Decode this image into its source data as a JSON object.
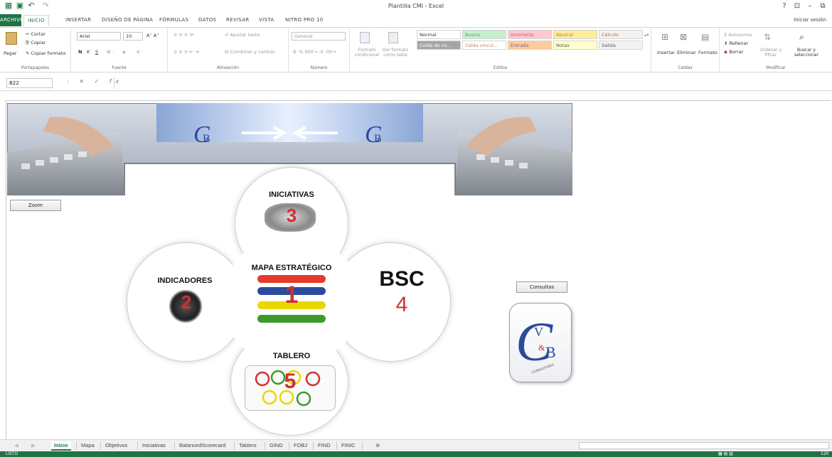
{
  "window": {
    "title": "Plantilla CMI - Excel",
    "help": "?",
    "sign_in": "Iniciar sesión"
  },
  "ribbon_tabs": [
    "ARCHIVO",
    "INICIO",
    "INSERTAR",
    "DISEÑO DE PÁGINA",
    "FÓRMULAS",
    "DATOS",
    "REVISAR",
    "VISTA",
    "NITRO PRO 10"
  ],
  "ribbon": {
    "clipboard": {
      "paste": "Pegar",
      "cut": "Cortar",
      "copy": "Copiar",
      "copy_format": "Copiar formato",
      "label": "Portapapeles"
    },
    "font": {
      "name": "Arial",
      "size": "10",
      "bold": "N",
      "italic": "K",
      "underline": "S",
      "label": "Fuente"
    },
    "alignment": {
      "wrap": "Ajustar texto",
      "merge": "Combinar y centrar",
      "label": "Alineación"
    },
    "number": {
      "format": "General",
      "label": "Número"
    },
    "styles": {
      "cond_format": "Formato condicional",
      "as_table": "Dar formato como tabla",
      "cells": [
        "Normal",
        "Buena",
        "Incorrecto",
        "Neutral",
        "Cálculo",
        "Celda de co...",
        "Celda vincul...",
        "Entrada",
        "Notas",
        "Salida"
      ],
      "label": "Estilos"
    },
    "cells": {
      "insert": "Insertar",
      "delete": "Eliminar",
      "format": "Formato",
      "label": "Celdas"
    },
    "editing": {
      "autosum": "Autosuma",
      "fill": "Rellenar",
      "clear": "Borrar",
      "sort": "Ordenar y filtrar",
      "find": "Buscar y seleccionar",
      "label": "Modificar"
    }
  },
  "formula_bar": {
    "name_box": "B22",
    "fx": "fx",
    "value": ""
  },
  "sheet": {
    "zoom_button": "Zoom",
    "consultas_button": "Consultas",
    "logo_text": "V&B",
    "logo_sub": "CONSULTORES",
    "nodes": {
      "iniciativas": {
        "label": "INICIATIVAS",
        "number": "3"
      },
      "indicadores": {
        "label": "INDICADORES",
        "number": "2"
      },
      "mapa": {
        "label": "MAPA ESTRATÉGICO",
        "number": "1"
      },
      "bsc": {
        "label": "BSC",
        "number": "4"
      },
      "tablero": {
        "label": "TABLERO",
        "number": "5"
      }
    }
  },
  "sheet_tabs": [
    "Inicio",
    "Mapa",
    "Objetivos",
    "Iniciativas",
    "BalancedScorecard",
    "Tablero",
    "GIND",
    "FOBJ",
    "FIND",
    "FINIC"
  ],
  "status": {
    "left": "LISTO",
    "zoom": "120"
  },
  "colors": {
    "excel_green": "#217346",
    "red": "#d03030",
    "blue": "#2a4a9c",
    "yellow": "#e8d800",
    "green": "#3a9a2a"
  }
}
